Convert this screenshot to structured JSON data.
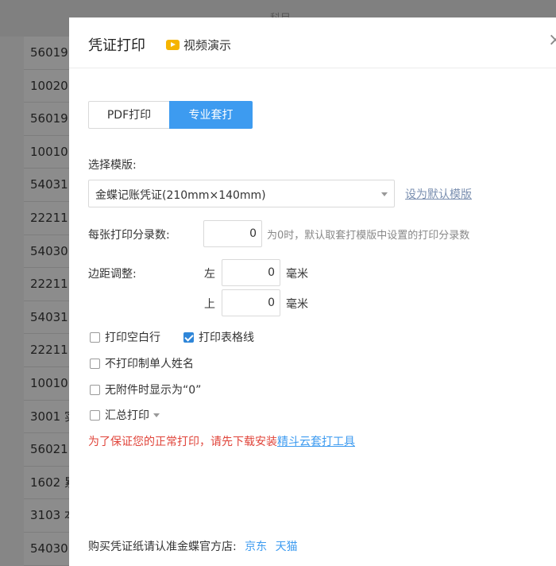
{
  "background_table": {
    "header_text": "科目",
    "rows": [
      "56019",
      "10020",
      "56019",
      "10010",
      "54031",
      "22211",
      "54030",
      "22211",
      "54031",
      "22211",
      "10010",
      "3001 实",
      "56021",
      "1602 累",
      "3103 本",
      "54030"
    ]
  },
  "dialog": {
    "title": "凭证打印",
    "video_label": "视频演示",
    "close_glyph": "×",
    "tabs": {
      "pdf": "PDF打印",
      "pro": "专业套打"
    },
    "template_label": "选择模版:",
    "template_value": "金蝶记账凭证(210mm×140mm)",
    "set_default_link": "设为默认模版",
    "entries_label": "每张打印分录数:",
    "entries_value": "0",
    "entries_hint": "为0时，默认取套打模版中设置的打印分录数",
    "margin_label": "边距调整:",
    "margin_left_label": "左",
    "margin_left_value": "0",
    "margin_top_label": "上",
    "margin_top_value": "0",
    "unit_mm": "毫米",
    "checkboxes": {
      "blank_rows": {
        "label": "打印空白行",
        "checked": false
      },
      "table_lines": {
        "label": "打印表格线",
        "checked": true
      },
      "no_maker": {
        "label": "不打印制单人姓名",
        "checked": false
      },
      "zero_attach": {
        "label": "无附件时显示为“0”",
        "checked": false
      },
      "summary": {
        "label": "汇总打印",
        "checked": false
      }
    },
    "warning_text": "为了保证您的正常打印，请先下载安装",
    "warning_link": "精斗云套打工具",
    "footer_text": "购买凭证纸请认准金蝶官方店:",
    "footer_jd": "京东",
    "footer_tmall": "天猫"
  },
  "colors": {
    "accent": "#3d9bf0",
    "warning": "#e0443a",
    "video_icon": "#f5b400"
  }
}
